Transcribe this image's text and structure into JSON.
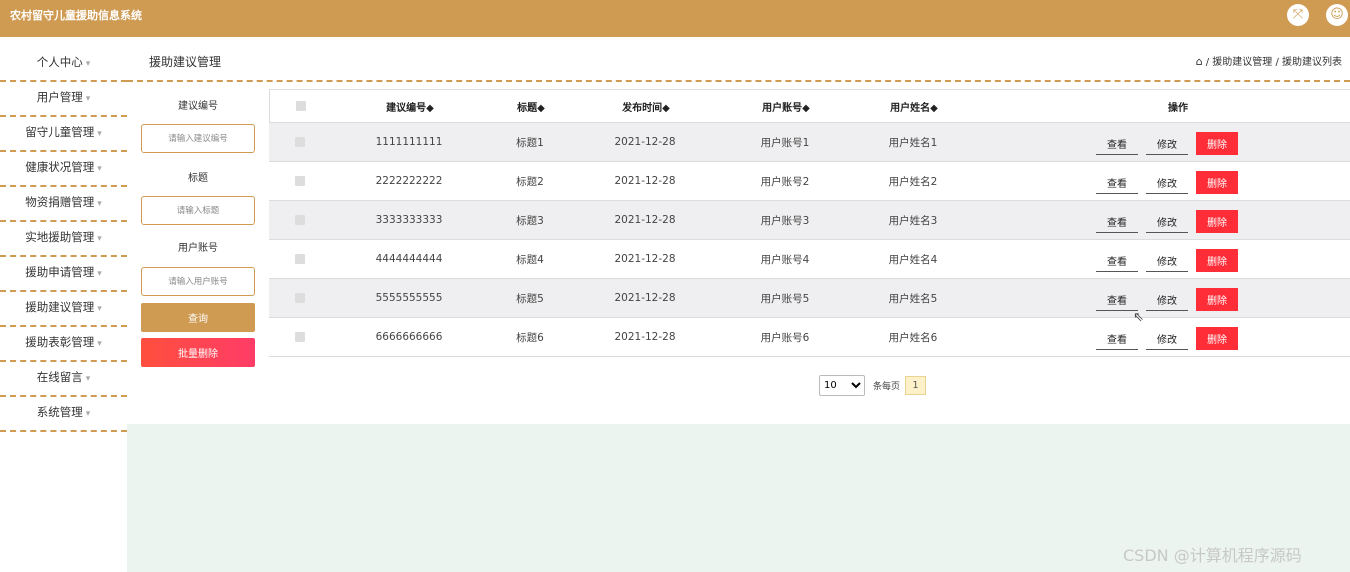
{
  "app": {
    "title": "农村留守儿童援助信息系统"
  },
  "topbar": {
    "fullscreen_icon": "fullscreen-icon",
    "user_icon": "user-icon"
  },
  "sidebar": {
    "items": [
      {
        "label": "个人中心"
      },
      {
        "label": "用户管理"
      },
      {
        "label": "留守儿童管理"
      },
      {
        "label": "健康状况管理"
      },
      {
        "label": "物资捐赠管理"
      },
      {
        "label": "实地援助管理"
      },
      {
        "label": "援助申请管理"
      },
      {
        "label": "援助建议管理"
      },
      {
        "label": "援助表彰管理"
      },
      {
        "label": "在线留言"
      },
      {
        "label": "系统管理"
      }
    ]
  },
  "header": {
    "page_title": "援助建议管理",
    "breadcrumb": "/ 援助建议管理 / 援助建议列表"
  },
  "filters": {
    "id_label": "建议编号",
    "id_placeholder": "请输入建议编号",
    "title_label": "标题",
    "title_placeholder": "请输入标题",
    "account_label": "用户账号",
    "account_placeholder": "请输入用户账号",
    "query_button": "查询",
    "batch_delete_button": "批量删除"
  },
  "table": {
    "headers": {
      "id": "建议编号◆",
      "title": "标题◆",
      "date": "发布时间◆",
      "account": "用户账号◆",
      "name": "用户姓名◆",
      "ops": "操作"
    },
    "rows": [
      {
        "id": "1111111111",
        "title": "标题1",
        "date": "2021-12-28",
        "account": "用户账号1",
        "name": "用户姓名1"
      },
      {
        "id": "2222222222",
        "title": "标题2",
        "date": "2021-12-28",
        "account": "用户账号2",
        "name": "用户姓名2"
      },
      {
        "id": "3333333333",
        "title": "标题3",
        "date": "2021-12-28",
        "account": "用户账号3",
        "name": "用户姓名3"
      },
      {
        "id": "4444444444",
        "title": "标题4",
        "date": "2021-12-28",
        "account": "用户账号4",
        "name": "用户姓名4"
      },
      {
        "id": "5555555555",
        "title": "标题5",
        "date": "2021-12-28",
        "account": "用户账号5",
        "name": "用户姓名5"
      },
      {
        "id": "6666666666",
        "title": "标题6",
        "date": "2021-12-28",
        "account": "用户账号6",
        "name": "用户姓名6"
      }
    ],
    "view_label": "查看",
    "edit_label": "修改",
    "delete_label": "删除"
  },
  "pagination": {
    "page_size": "10",
    "per_page_label": "条每页",
    "current_page": "1"
  },
  "watermark": "CSDN @计算机程序源码",
  "colors": {
    "accent": "#cf9a52",
    "danger": "#ff2d38",
    "bottom_bg": "#ebf4ee"
  }
}
